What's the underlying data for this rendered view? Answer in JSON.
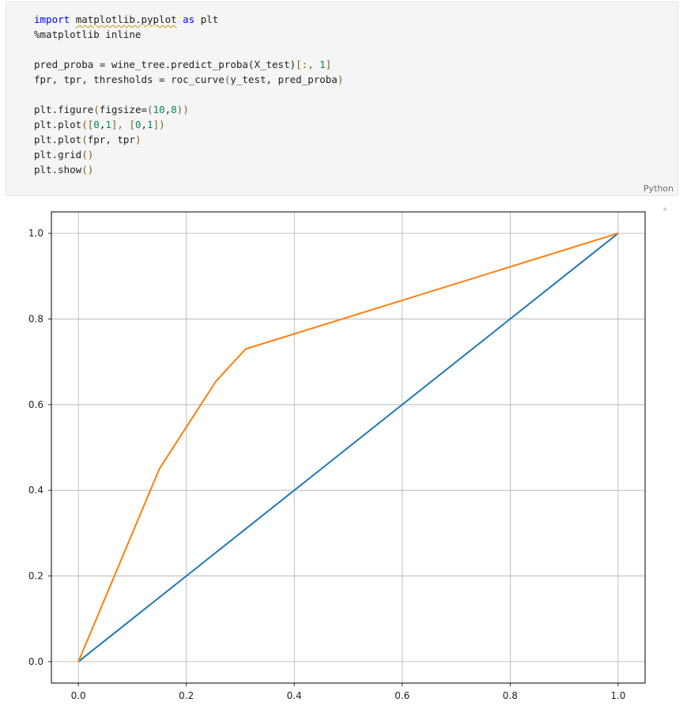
{
  "cell": {
    "language": "Python",
    "code_lines": [
      [
        {
          "t": "import",
          "c": "kw"
        },
        {
          "t": " "
        },
        {
          "t": "matplotlib.pyplot",
          "c": "squiggle"
        },
        {
          "t": " "
        },
        {
          "t": "as",
          "c": "kw"
        },
        {
          "t": " plt"
        }
      ],
      [
        {
          "t": "%matplotlib inline"
        }
      ],
      [
        {
          "t": ""
        }
      ],
      [
        {
          "t": "pred_proba = wine_tree.predict_proba(X_test)"
        },
        {
          "t": "[:, ",
          "c": "br"
        },
        {
          "t": "1",
          "c": "num"
        },
        {
          "t": "]",
          "c": "br"
        }
      ],
      [
        {
          "t": "fpr, tpr, thresholds = roc_curve"
        },
        {
          "t": "(",
          "c": "br"
        },
        {
          "t": "y_test, pred_proba"
        },
        {
          "t": ")",
          "c": "br"
        }
      ],
      [
        {
          "t": ""
        }
      ],
      [
        {
          "t": "plt.figure"
        },
        {
          "t": "(",
          "c": "br"
        },
        {
          "t": "figsize=",
          "c": ""
        },
        {
          "t": "(",
          "c": "br"
        },
        {
          "t": "10",
          "c": "num"
        },
        {
          "t": ",",
          "c": ""
        },
        {
          "t": "8",
          "c": "num"
        },
        {
          "t": "))",
          "c": "br"
        }
      ],
      [
        {
          "t": "plt.plot"
        },
        {
          "t": "([",
          "c": "br"
        },
        {
          "t": "0",
          "c": "num"
        },
        {
          "t": ",",
          "c": ""
        },
        {
          "t": "1",
          "c": "num"
        },
        {
          "t": "], [",
          "c": "br"
        },
        {
          "t": "0",
          "c": "num"
        },
        {
          "t": ",",
          "c": ""
        },
        {
          "t": "1",
          "c": "num"
        },
        {
          "t": "])",
          "c": "br"
        }
      ],
      [
        {
          "t": "plt.plot"
        },
        {
          "t": "(",
          "c": "br"
        },
        {
          "t": "fpr, tpr"
        },
        {
          "t": ")",
          "c": "br"
        }
      ],
      [
        {
          "t": "plt.grid"
        },
        {
          "t": "()",
          "c": "br"
        }
      ],
      [
        {
          "t": "plt.show"
        },
        {
          "t": "()",
          "c": "br"
        }
      ]
    ]
  },
  "chart_data": {
    "type": "line",
    "title": "",
    "xlabel": "",
    "ylabel": "",
    "xlim": [
      -0.05,
      1.05
    ],
    "ylim": [
      -0.05,
      1.05
    ],
    "xticks": [
      "0.0",
      "0.2",
      "0.4",
      "0.6",
      "0.8",
      "1.0"
    ],
    "yticks": [
      "0.0",
      "0.2",
      "0.4",
      "0.6",
      "0.8",
      "1.0"
    ],
    "grid": true,
    "series": [
      {
        "color": "#1f77b4",
        "x": [
          0,
          1
        ],
        "y": [
          0,
          1
        ]
      },
      {
        "color": "#ff7f0e",
        "x": [
          0,
          0.15,
          0.255,
          0.31,
          1.0
        ],
        "y": [
          0,
          0.45,
          0.655,
          0.73,
          1.0
        ]
      }
    ]
  }
}
